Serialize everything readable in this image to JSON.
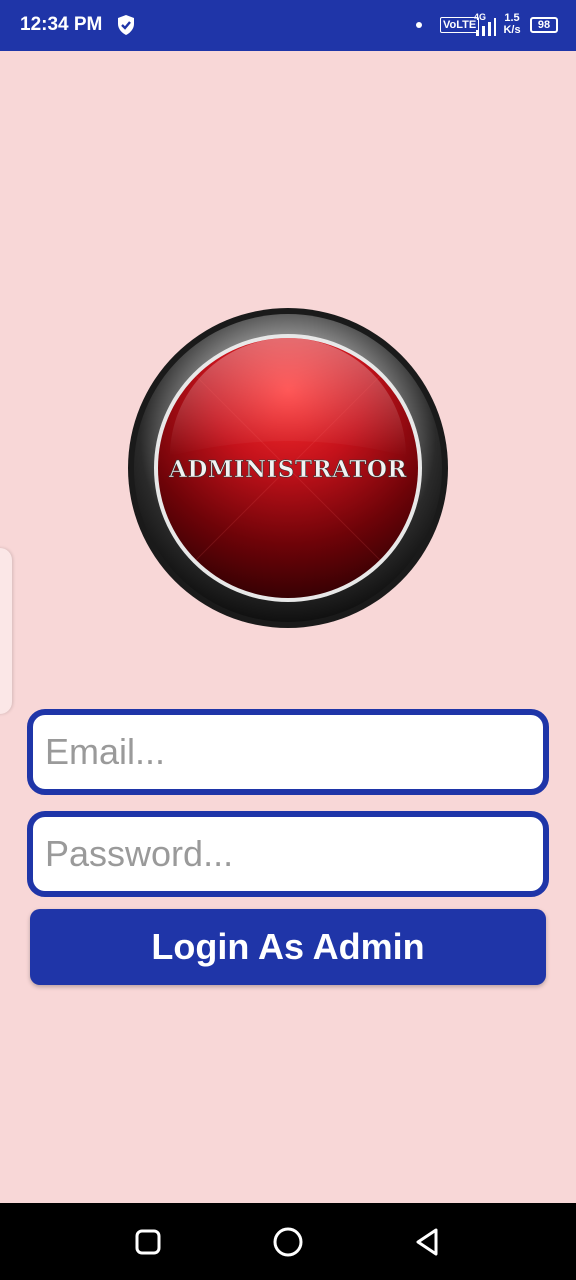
{
  "status_bar": {
    "time": "12:34 PM",
    "volte": "VoLTE",
    "network": "4G",
    "speed_value": "1.5",
    "speed_unit": "K/s",
    "battery": "98"
  },
  "logo": {
    "text": "ADMINISTRATOR",
    "colors": {
      "inner": "#c4121b",
      "dark": "#3a0003",
      "ring": "#1a1a1a"
    }
  },
  "form": {
    "email_placeholder": "Email...",
    "password_placeholder": "Password...",
    "login_label": "Login As Admin"
  },
  "theme": {
    "background": "#f8d7d7",
    "accent": "#1f35a8"
  },
  "nav_bar": {
    "icons": [
      "square-recents-icon",
      "circle-home-icon",
      "triangle-back-icon"
    ]
  }
}
